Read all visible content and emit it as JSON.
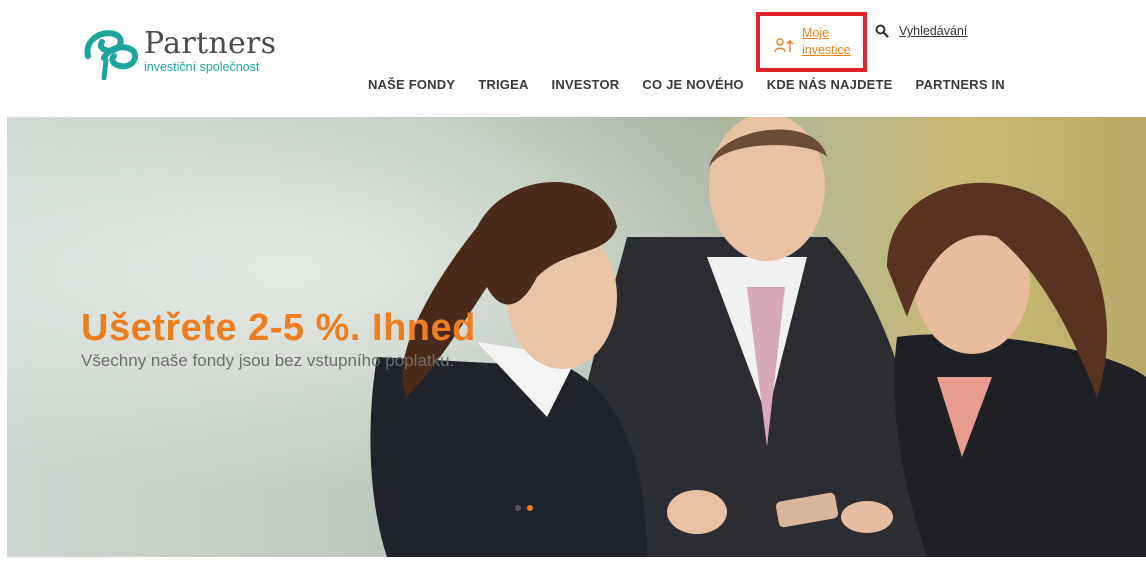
{
  "brand": {
    "name": "Partners",
    "tagline": "investiční společnost",
    "accent": "#ee7d1e",
    "teal": "#1ea59a"
  },
  "utility": {
    "moje_investice": "Moje investice",
    "moje_icon": "user-login-icon",
    "search_label": "Vyhledávání",
    "search_icon": "search-icon",
    "highlight_color": "#e4222c"
  },
  "nav": {
    "items": [
      {
        "label": "NAŠE FONDY"
      },
      {
        "label": "TRIGEA"
      },
      {
        "label": "INVESTOR"
      },
      {
        "label": "CO JE NOVÉHO"
      },
      {
        "label": "KDE NÁS NAJDETE"
      },
      {
        "label": "PARTNERS IN"
      }
    ]
  },
  "hero": {
    "headline": "Ušetřete 2-5 %. Ihned",
    "subline": "Všechny naše fondy jsou bez vstupního poplatku.",
    "slides_count": 2,
    "active_slide": 2
  }
}
